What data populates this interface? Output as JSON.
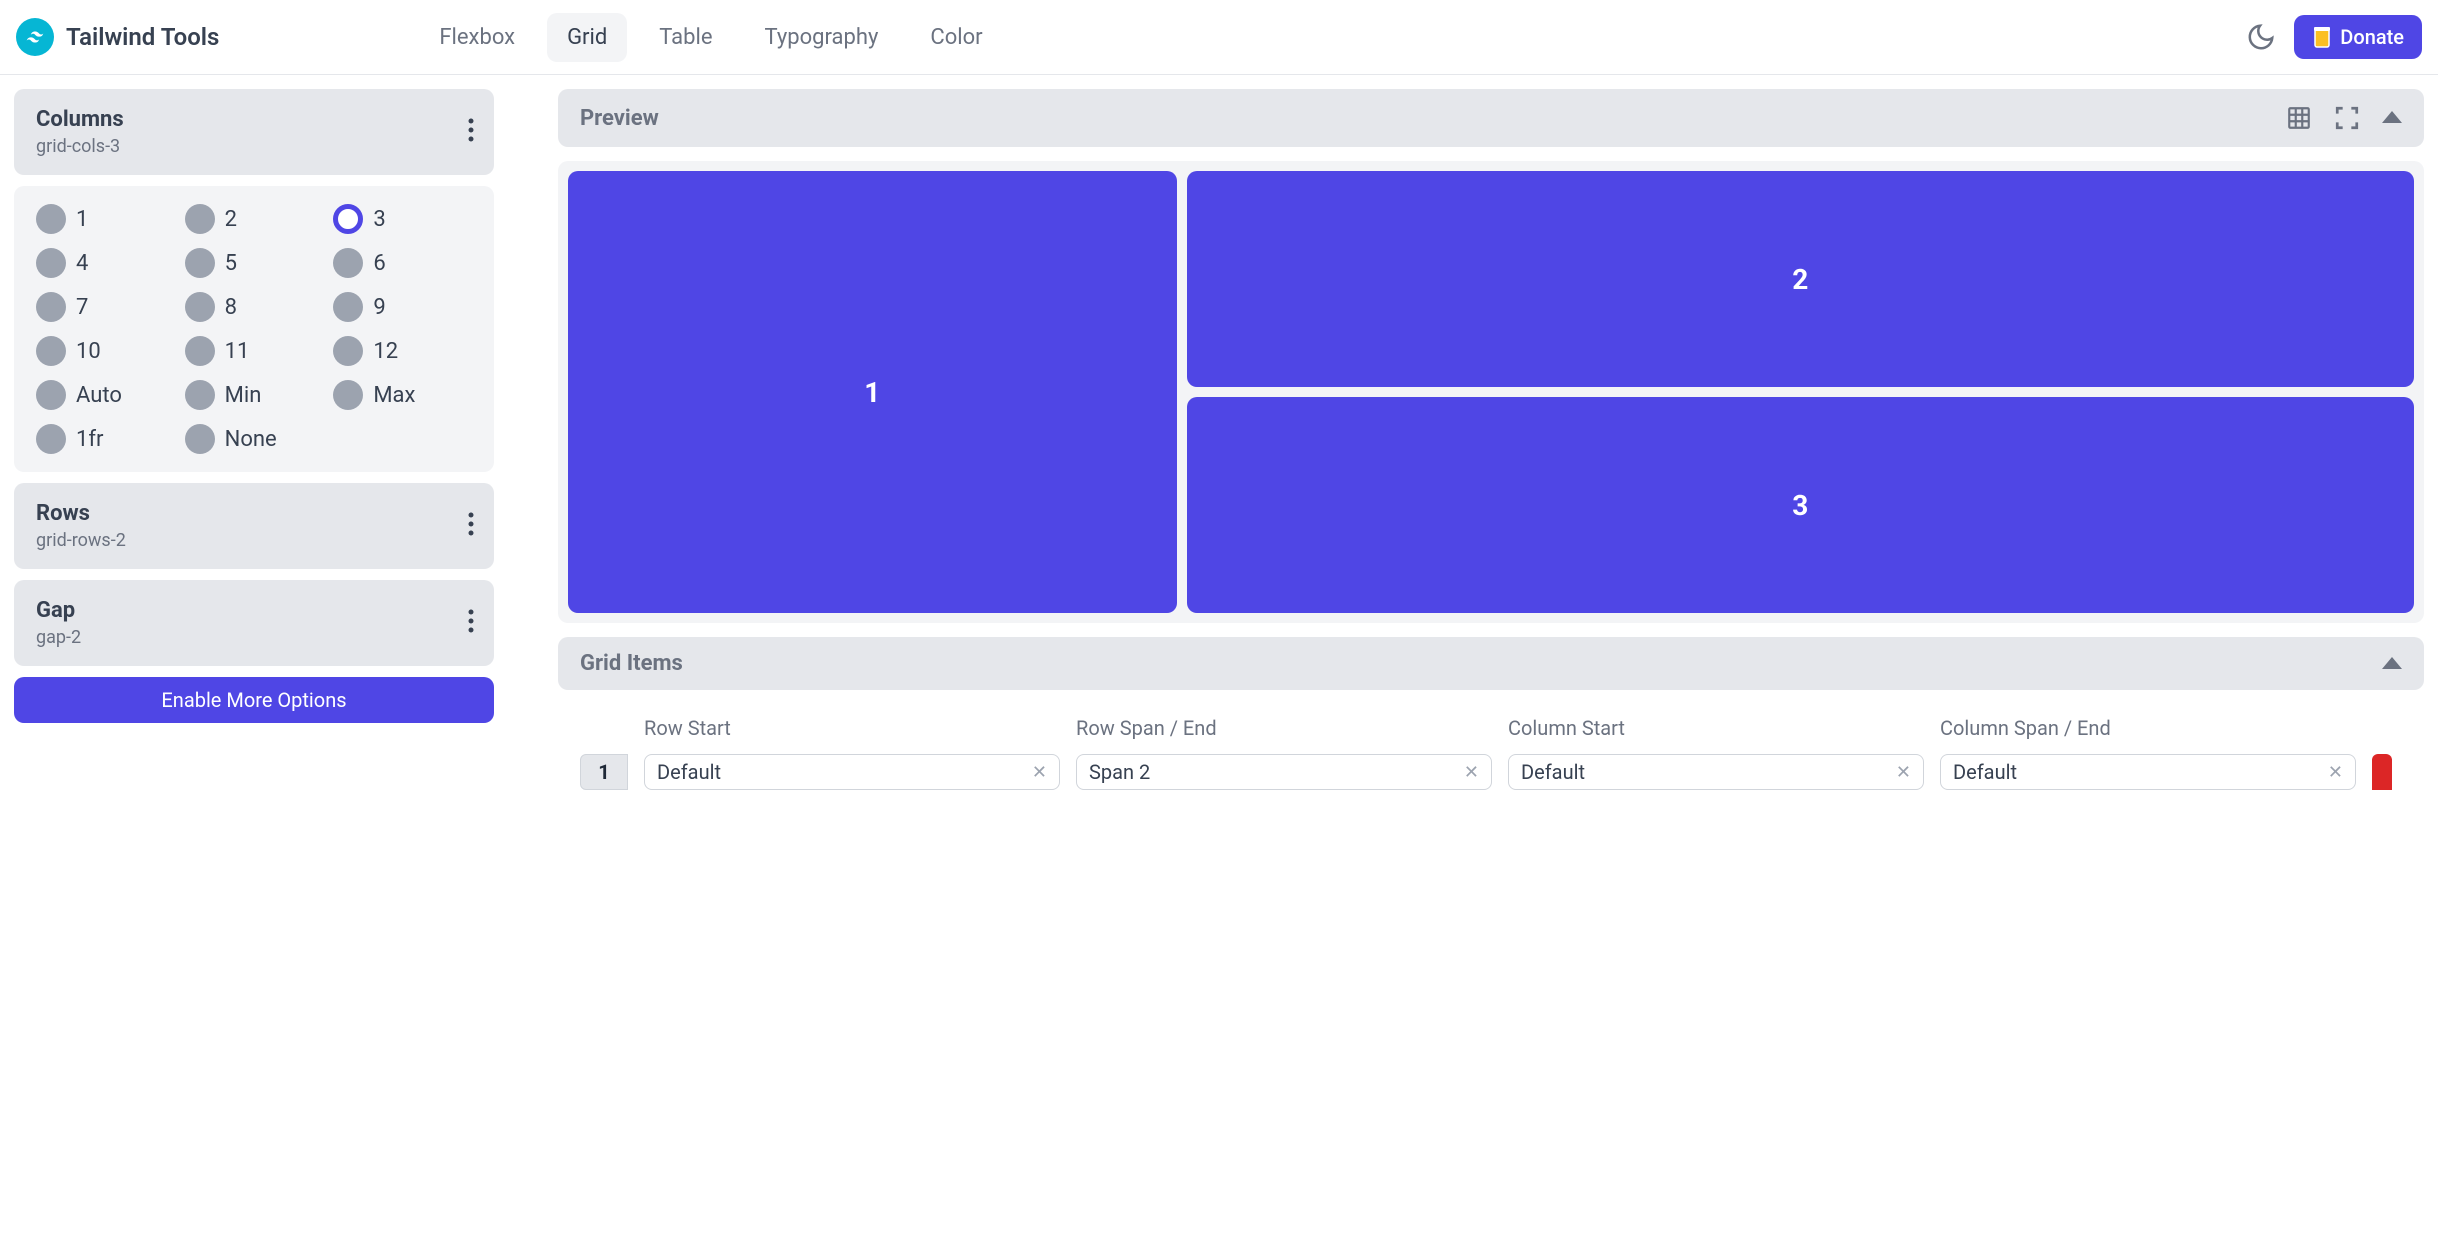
{
  "header": {
    "brand": "Tailwind Tools",
    "nav": [
      "Flexbox",
      "Grid",
      "Table",
      "Typography",
      "Color"
    ],
    "active_nav": "Grid",
    "donate": "Donate"
  },
  "columns": {
    "title": "Columns",
    "subtitle": "grid-cols-3",
    "options": [
      "1",
      "2",
      "3",
      "4",
      "5",
      "6",
      "7",
      "8",
      "9",
      "10",
      "11",
      "12",
      "Auto",
      "Min",
      "Max",
      "1fr",
      "None"
    ],
    "selected": "3"
  },
  "rows": {
    "title": "Rows",
    "subtitle": "grid-rows-2"
  },
  "gap": {
    "title": "Gap",
    "subtitle": "gap-2"
  },
  "enable_button": "Enable More Options",
  "preview": {
    "title": "Preview",
    "cells": [
      "1",
      "2",
      "3"
    ]
  },
  "grid_items": {
    "title": "Grid Items",
    "headers": [
      "Row Start",
      "Row Span / End",
      "Column Start",
      "Column Span / End"
    ],
    "row": {
      "number": "1",
      "row_start": "Default",
      "row_span": "Span 2",
      "col_start": "Default",
      "col_span": "Default"
    }
  }
}
